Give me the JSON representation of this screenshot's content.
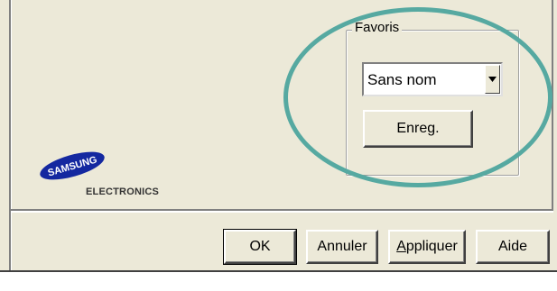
{
  "favorites": {
    "group_label": "Favoris",
    "selected_value": "Sans nom",
    "save_label": "Enreg."
  },
  "logo": {
    "brand": "SAMSUNG",
    "sub": "ELECTRONICS"
  },
  "buttons": {
    "ok": "OK",
    "cancel": "Annuler",
    "apply_first": "A",
    "apply_rest": "ppliquer",
    "help": "Aide"
  },
  "colors": {
    "dialog_bg": "#ece9d8",
    "highlight_ring": "#56a9a1",
    "logo_blue": "#1428a0"
  },
  "icons": {
    "dropdown": "chevron-down-icon"
  }
}
